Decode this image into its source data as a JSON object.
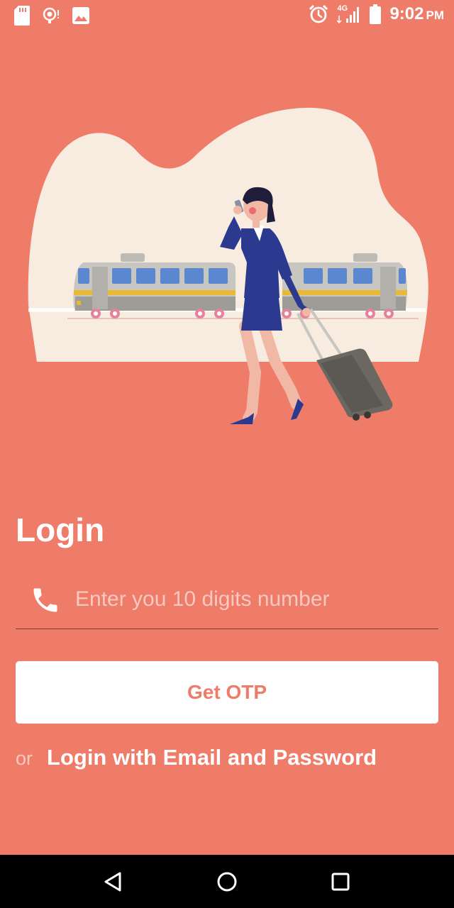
{
  "status_bar": {
    "time": "9:02",
    "ampm": "PM",
    "network": "4G",
    "icons": [
      "sd-card-icon",
      "hotspot-icon",
      "image-icon",
      "alarm-icon",
      "signal-icon",
      "battery-icon"
    ]
  },
  "login": {
    "title": "Login",
    "phone_placeholder": "Enter you 10 digits number",
    "get_otp_label": "Get OTP",
    "or_label": "or",
    "email_login_label": "Login with Email and Password"
  },
  "nav_bar": {
    "icons": [
      "back-icon",
      "home-icon",
      "recents-icon"
    ]
  },
  "colors": {
    "background": "#ef7b69",
    "blob": "#f8ece1",
    "button_bg": "#ffffff",
    "button_text": "#ef7b69",
    "suit": "#2b3a8f",
    "train": "#c8c6c0"
  }
}
